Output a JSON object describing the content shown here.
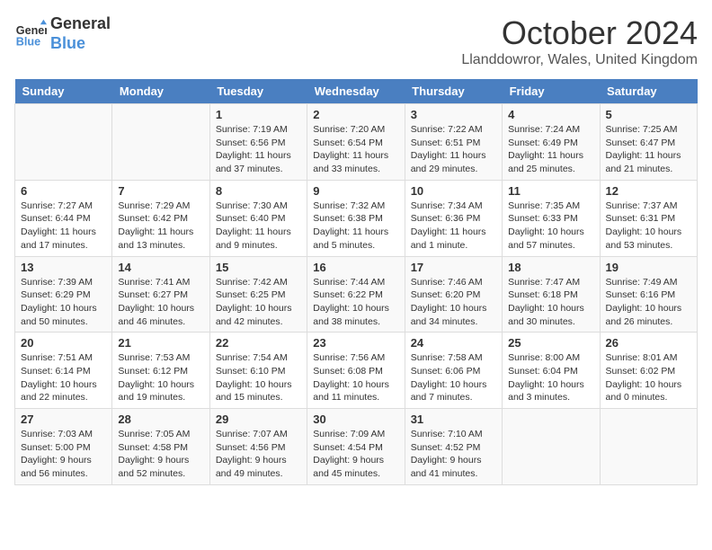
{
  "header": {
    "logo_line1": "General",
    "logo_line2": "Blue",
    "month": "October 2024",
    "location": "Llanddowror, Wales, United Kingdom"
  },
  "days_of_week": [
    "Sunday",
    "Monday",
    "Tuesday",
    "Wednesday",
    "Thursday",
    "Friday",
    "Saturday"
  ],
  "weeks": [
    [
      {
        "day": "",
        "info": ""
      },
      {
        "day": "",
        "info": ""
      },
      {
        "day": "1",
        "info": "Sunrise: 7:19 AM\nSunset: 6:56 PM\nDaylight: 11 hours and 37 minutes."
      },
      {
        "day": "2",
        "info": "Sunrise: 7:20 AM\nSunset: 6:54 PM\nDaylight: 11 hours and 33 minutes."
      },
      {
        "day": "3",
        "info": "Sunrise: 7:22 AM\nSunset: 6:51 PM\nDaylight: 11 hours and 29 minutes."
      },
      {
        "day": "4",
        "info": "Sunrise: 7:24 AM\nSunset: 6:49 PM\nDaylight: 11 hours and 25 minutes."
      },
      {
        "day": "5",
        "info": "Sunrise: 7:25 AM\nSunset: 6:47 PM\nDaylight: 11 hours and 21 minutes."
      }
    ],
    [
      {
        "day": "6",
        "info": "Sunrise: 7:27 AM\nSunset: 6:44 PM\nDaylight: 11 hours and 17 minutes."
      },
      {
        "day": "7",
        "info": "Sunrise: 7:29 AM\nSunset: 6:42 PM\nDaylight: 11 hours and 13 minutes."
      },
      {
        "day": "8",
        "info": "Sunrise: 7:30 AM\nSunset: 6:40 PM\nDaylight: 11 hours and 9 minutes."
      },
      {
        "day": "9",
        "info": "Sunrise: 7:32 AM\nSunset: 6:38 PM\nDaylight: 11 hours and 5 minutes."
      },
      {
        "day": "10",
        "info": "Sunrise: 7:34 AM\nSunset: 6:36 PM\nDaylight: 11 hours and 1 minute."
      },
      {
        "day": "11",
        "info": "Sunrise: 7:35 AM\nSunset: 6:33 PM\nDaylight: 10 hours and 57 minutes."
      },
      {
        "day": "12",
        "info": "Sunrise: 7:37 AM\nSunset: 6:31 PM\nDaylight: 10 hours and 53 minutes."
      }
    ],
    [
      {
        "day": "13",
        "info": "Sunrise: 7:39 AM\nSunset: 6:29 PM\nDaylight: 10 hours and 50 minutes."
      },
      {
        "day": "14",
        "info": "Sunrise: 7:41 AM\nSunset: 6:27 PM\nDaylight: 10 hours and 46 minutes."
      },
      {
        "day": "15",
        "info": "Sunrise: 7:42 AM\nSunset: 6:25 PM\nDaylight: 10 hours and 42 minutes."
      },
      {
        "day": "16",
        "info": "Sunrise: 7:44 AM\nSunset: 6:22 PM\nDaylight: 10 hours and 38 minutes."
      },
      {
        "day": "17",
        "info": "Sunrise: 7:46 AM\nSunset: 6:20 PM\nDaylight: 10 hours and 34 minutes."
      },
      {
        "day": "18",
        "info": "Sunrise: 7:47 AM\nSunset: 6:18 PM\nDaylight: 10 hours and 30 minutes."
      },
      {
        "day": "19",
        "info": "Sunrise: 7:49 AM\nSunset: 6:16 PM\nDaylight: 10 hours and 26 minutes."
      }
    ],
    [
      {
        "day": "20",
        "info": "Sunrise: 7:51 AM\nSunset: 6:14 PM\nDaylight: 10 hours and 22 minutes."
      },
      {
        "day": "21",
        "info": "Sunrise: 7:53 AM\nSunset: 6:12 PM\nDaylight: 10 hours and 19 minutes."
      },
      {
        "day": "22",
        "info": "Sunrise: 7:54 AM\nSunset: 6:10 PM\nDaylight: 10 hours and 15 minutes."
      },
      {
        "day": "23",
        "info": "Sunrise: 7:56 AM\nSunset: 6:08 PM\nDaylight: 10 hours and 11 minutes."
      },
      {
        "day": "24",
        "info": "Sunrise: 7:58 AM\nSunset: 6:06 PM\nDaylight: 10 hours and 7 minutes."
      },
      {
        "day": "25",
        "info": "Sunrise: 8:00 AM\nSunset: 6:04 PM\nDaylight: 10 hours and 3 minutes."
      },
      {
        "day": "26",
        "info": "Sunrise: 8:01 AM\nSunset: 6:02 PM\nDaylight: 10 hours and 0 minutes."
      }
    ],
    [
      {
        "day": "27",
        "info": "Sunrise: 7:03 AM\nSunset: 5:00 PM\nDaylight: 9 hours and 56 minutes."
      },
      {
        "day": "28",
        "info": "Sunrise: 7:05 AM\nSunset: 4:58 PM\nDaylight: 9 hours and 52 minutes."
      },
      {
        "day": "29",
        "info": "Sunrise: 7:07 AM\nSunset: 4:56 PM\nDaylight: 9 hours and 49 minutes."
      },
      {
        "day": "30",
        "info": "Sunrise: 7:09 AM\nSunset: 4:54 PM\nDaylight: 9 hours and 45 minutes."
      },
      {
        "day": "31",
        "info": "Sunrise: 7:10 AM\nSunset: 4:52 PM\nDaylight: 9 hours and 41 minutes."
      },
      {
        "day": "",
        "info": ""
      },
      {
        "day": "",
        "info": ""
      }
    ]
  ]
}
